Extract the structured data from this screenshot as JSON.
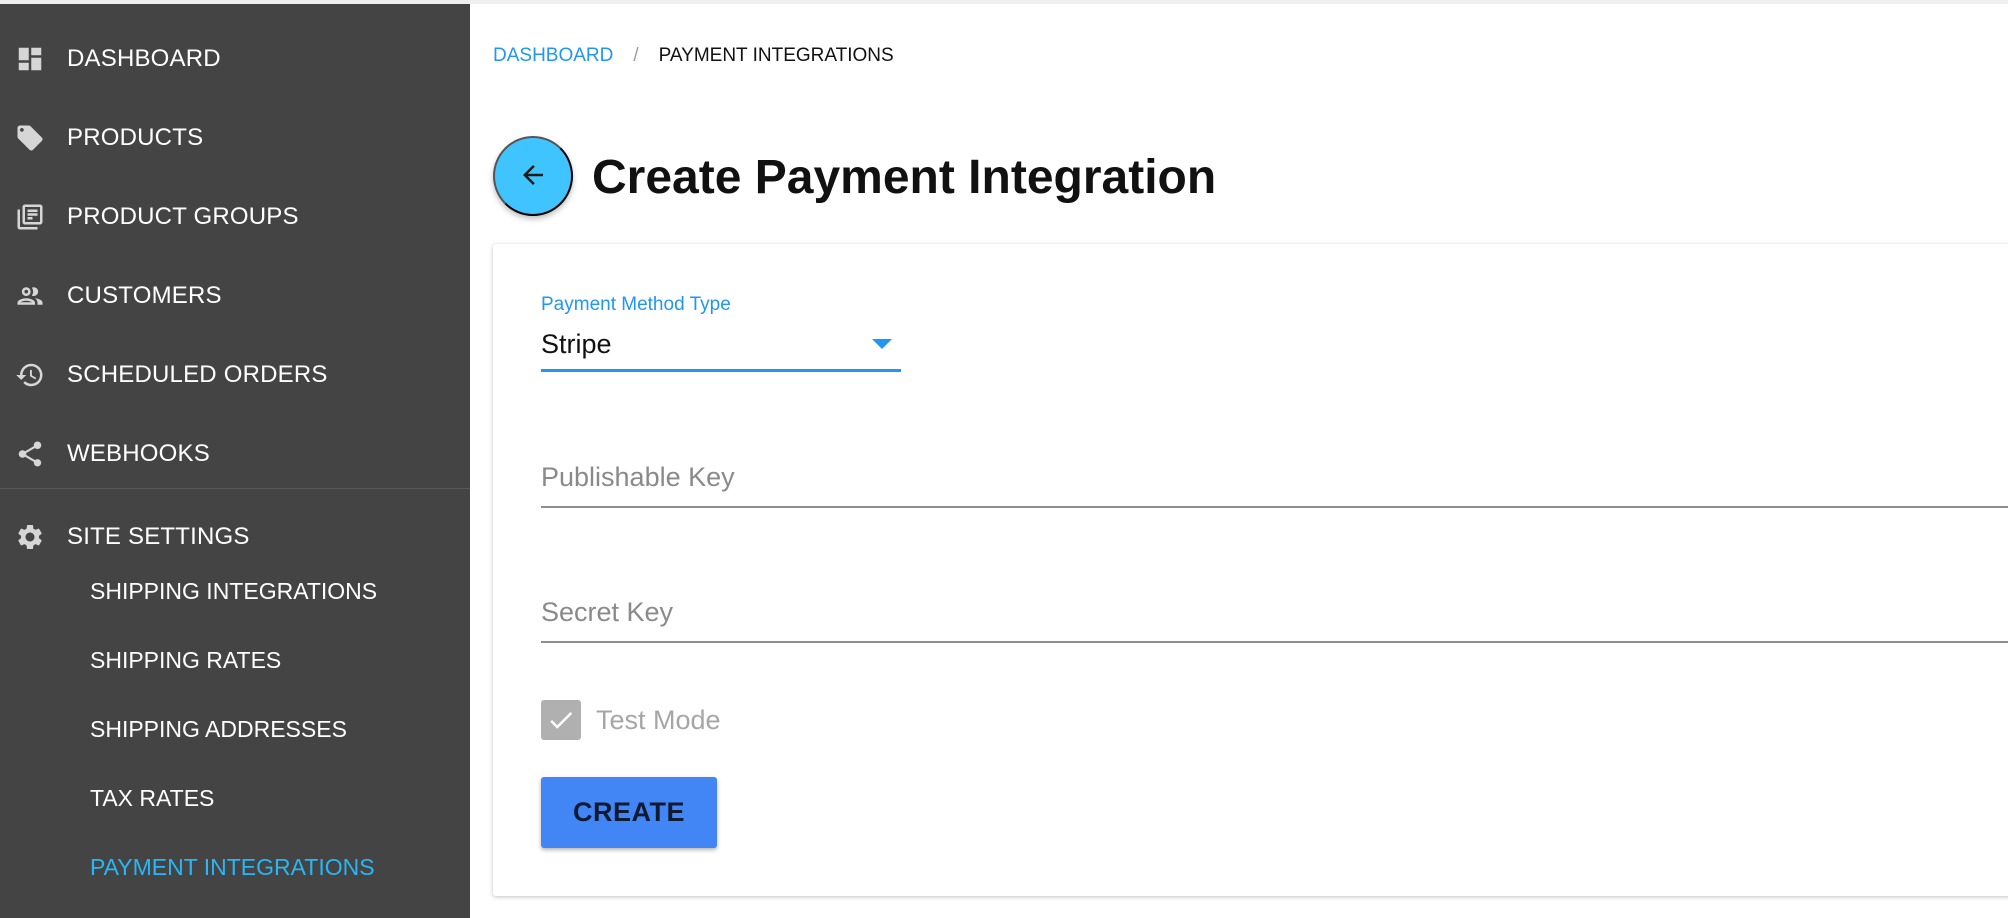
{
  "sidebar": {
    "items": [
      {
        "label": "DASHBOARD",
        "icon": "dashboard-icon"
      },
      {
        "label": "PRODUCTS",
        "icon": "tag-icon"
      },
      {
        "label": "PRODUCT GROUPS",
        "icon": "library-icon"
      },
      {
        "label": "CUSTOMERS",
        "icon": "people-icon"
      },
      {
        "label": "SCHEDULED ORDERS",
        "icon": "history-icon"
      },
      {
        "label": "WEBHOOKS",
        "icon": "share-icon"
      },
      {
        "label": "SITE SETTINGS",
        "icon": "gear-icon"
      }
    ],
    "sub_items": [
      {
        "label": "SHIPPING INTEGRATIONS"
      },
      {
        "label": "SHIPPING RATES"
      },
      {
        "label": "SHIPPING ADDRESSES"
      },
      {
        "label": "TAX RATES"
      },
      {
        "label": "PAYMENT INTEGRATIONS",
        "active": true
      }
    ]
  },
  "breadcrumb": {
    "home": "DASHBOARD",
    "separator": "/",
    "current": "PAYMENT INTEGRATIONS"
  },
  "page": {
    "title": "Create Payment Integration",
    "back_icon": "arrow-left-icon"
  },
  "form": {
    "payment_method": {
      "label": "Payment Method Type",
      "value": "Stripe"
    },
    "publishable_key": {
      "placeholder": "Publishable Key",
      "value": ""
    },
    "secret_key": {
      "placeholder": "Secret Key",
      "value": ""
    },
    "test_mode": {
      "label": "Test Mode",
      "checked": true
    },
    "submit_label": "CREATE"
  },
  "colors": {
    "sidebar_bg": "#444444",
    "accent": "#2196f3",
    "active_nav": "#29b6f6",
    "back_button": "#40c4ff",
    "create_button": "#4285f4"
  }
}
